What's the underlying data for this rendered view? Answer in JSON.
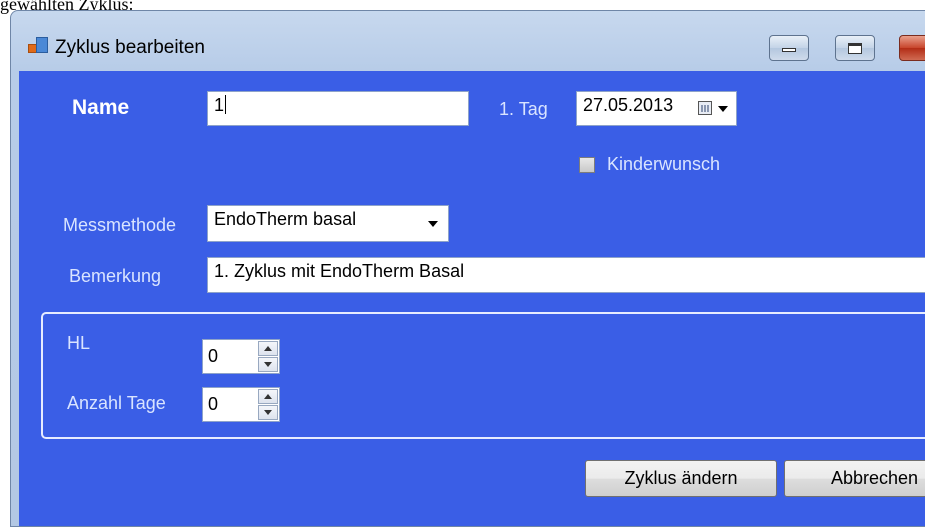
{
  "caption": "gewählten Zyklus:",
  "window": {
    "title": "Zyklus bearbeiten",
    "buttons": [
      "minimize",
      "maximize",
      "close"
    ]
  },
  "form": {
    "name_label": "Name",
    "name_value": "1",
    "first_day_label": "1. Tag",
    "first_day_value": "27.05.2013",
    "kinderwunsch_label": "Kinderwunsch",
    "kinderwunsch_checked": false,
    "messmethode_label": "Messmethode",
    "messmethode_value": "EndoTherm basal",
    "bemerkung_label": "Bemerkung",
    "bemerkung_value": "1. Zyklus mit EndoTherm Basal",
    "hl_label": "HL",
    "hl_value": "0",
    "anzahl_tage_label": "Anzahl Tage",
    "anzahl_tage_value": "0"
  },
  "actions": {
    "save_label": "Zyklus ändern",
    "cancel_label": "Abbrechen"
  },
  "colors": {
    "client_background": "#3a5ee6",
    "titlebar": "#c7d8ee"
  }
}
